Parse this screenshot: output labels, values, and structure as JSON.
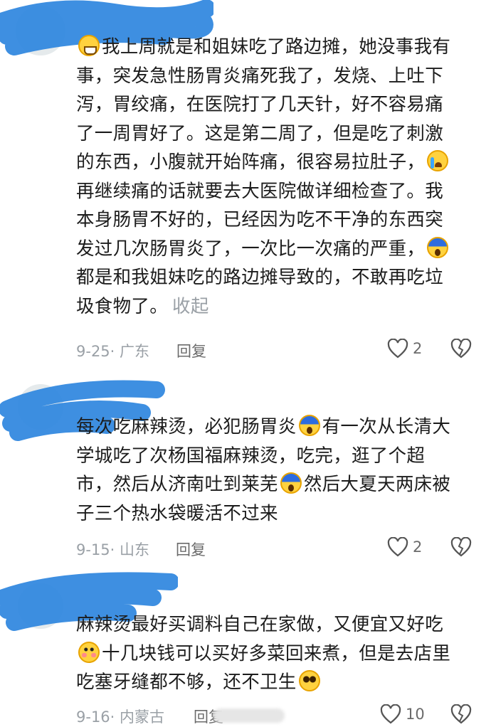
{
  "comments": [
    {
      "lines": [
        "我上周就是和姐妹吃了路边摊，她没事我有",
        "事，突发急性肠胃炎痛死我了，发烧、上吐下",
        "泻，胃绞痛，在医院打了几天针，好不容易痛",
        "了一周胃好了。这是第二周了，但是吃了刺激",
        "的东西，小腹就开始阵痛，很容易拉肚子，",
        "再继续痛的话就要去大医院做详细检查了。我",
        "本身肠胃不好的，已经因为吃不干净的东西突",
        "发过几次肠胃炎了，一次比一次痛的严重，",
        "都是和我姐妹吃的路边摊导致的，不敢再吃垃",
        "圾食物了。"
      ],
      "collapse_label": "收起",
      "date": "9-25",
      "location": "广东",
      "reply_label": "回复",
      "likes": "2"
    },
    {
      "lines": [
        "每次吃麻辣烫，必犯肠胃炎",
        "有一次从长清大",
        "学城吃了次杨国福麻辣烫，吃完，逛了个超",
        "市，然后从济南吐到莱芜",
        "然后大夏天两床被",
        "子三个热水袋暖活不过来"
      ],
      "date": "9-15",
      "location": "山东",
      "reply_label": "回复",
      "likes": "2"
    },
    {
      "lines": [
        "麻辣烫最好买调料自己在家做，又便宜又好吃",
        "十几块钱可以买好多菜回来煮，但是去店里",
        "吃塞牙缝都不够，还不卫生"
      ],
      "date": "9-16",
      "location": "内蒙古",
      "reply_label": "回复",
      "likes": "10"
    }
  ],
  "icons": {
    "grin": "grinning-sweat-emoji-icon",
    "cry": "crying-emoji-icon",
    "scream": "screaming-emoji-icon",
    "flush": "flushed-emoji-icon",
    "plead": "pleading-emoji-icon",
    "like": "heart-icon",
    "dislike": "broken-heart-icon"
  },
  "colors": {
    "scribble": "#2e86de",
    "meta_text": "#9aa0a6",
    "body_text": "#1c1c1c"
  }
}
